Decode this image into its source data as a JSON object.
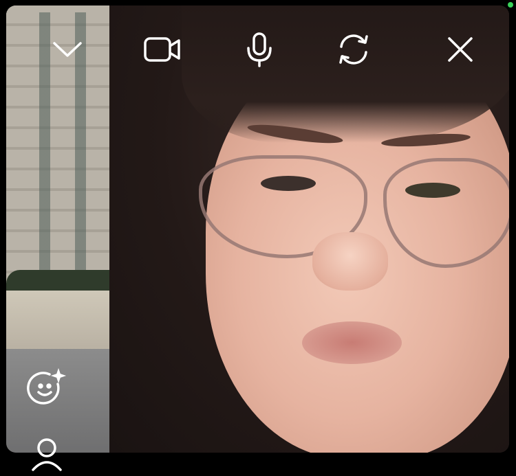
{
  "window": {
    "status_color": "#3ad15a",
    "icon_color": "#ffffff"
  },
  "toolbar": {
    "buttons": [
      {
        "icon": "chevron-down-icon",
        "action": "minimize"
      },
      {
        "icon": "video-camera-icon",
        "action": "toggle-camera"
      },
      {
        "icon": "microphone-icon",
        "action": "toggle-mute"
      },
      {
        "icon": "switch-camera-icon",
        "action": "flip-camera"
      },
      {
        "icon": "close-icon",
        "action": "end-call"
      }
    ]
  },
  "side_controls": [
    {
      "icon": "face-filter-sparkle-icon",
      "action": "effects"
    },
    {
      "icon": "add-person-icon",
      "action": "add-participant"
    }
  ]
}
